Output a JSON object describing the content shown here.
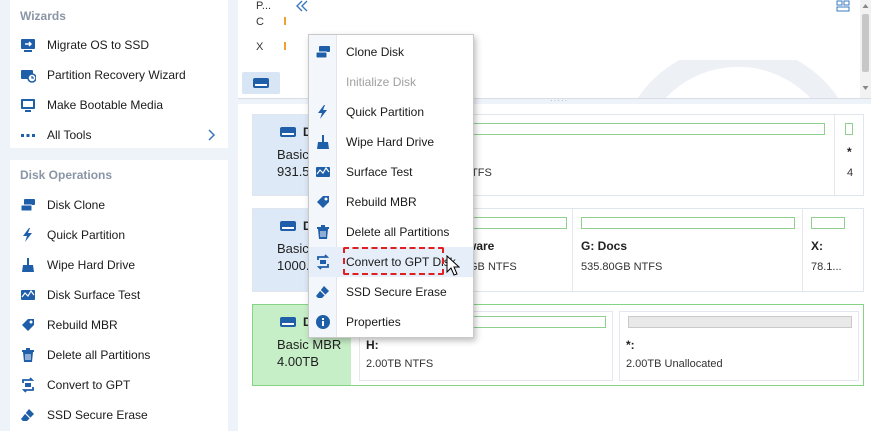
{
  "sidebar": {
    "wizards": {
      "title": "Wizards",
      "items": [
        {
          "label": "Migrate OS to SSD",
          "icon": "migrate-icon"
        },
        {
          "label": "Partition Recovery Wizard",
          "icon": "recovery-icon"
        },
        {
          "label": "Make Bootable Media",
          "icon": "bootable-media-icon"
        },
        {
          "label": "All Tools",
          "icon": "more-icon"
        }
      ]
    },
    "operations": {
      "title": "Disk Operations",
      "items": [
        {
          "label": "Disk Clone",
          "icon": "disk-clone-icon"
        },
        {
          "label": "Quick Partition",
          "icon": "lightning-icon"
        },
        {
          "label": "Wipe Hard Drive",
          "icon": "broom-icon"
        },
        {
          "label": "Disk Surface Test",
          "icon": "surface-test-icon"
        },
        {
          "label": "Rebuild MBR",
          "icon": "rebuild-icon"
        },
        {
          "label": "Delete all Partitions",
          "icon": "trash-icon"
        },
        {
          "label": "Convert to GPT",
          "icon": "convert-icon"
        },
        {
          "label": "SSD Secure Erase",
          "icon": "eraser-icon"
        }
      ]
    }
  },
  "top": {
    "col_label": "P...",
    "row1": "C",
    "row2": "X"
  },
  "disks": [
    {
      "name": "D",
      "type": "Basic",
      "size": "931.5",
      "partitions": [
        {
          "label": "",
          "info": "TFS"
        },
        {
          "label": "*",
          "info": "4"
        }
      ]
    },
    {
      "name": "D",
      "type": "Basic",
      "size": "1000.",
      "partitions": [
        {
          "label": "ware",
          "info": "GB NTFS"
        },
        {
          "label": "G: Docs",
          "info": "535.80GB NTFS"
        },
        {
          "label": "X:",
          "info": "78.1..."
        }
      ]
    },
    {
      "name": "D",
      "type": "Basic MBR",
      "size": "4.00TB",
      "partitions": [
        {
          "label": "H:",
          "info": "2.00TB NTFS"
        },
        {
          "label": "*:",
          "info": "2.00TB Unallocated"
        }
      ]
    }
  ],
  "context_menu": {
    "items": [
      {
        "label": "Clone Disk",
        "icon": "disk-clone-icon",
        "disabled": false
      },
      {
        "label": "Initialize Disk",
        "icon": "",
        "disabled": true
      },
      {
        "label": "Quick Partition",
        "icon": "lightning-icon",
        "disabled": false
      },
      {
        "label": "Wipe Hard Drive",
        "icon": "broom-icon",
        "disabled": false
      },
      {
        "label": "Surface Test",
        "icon": "surface-test-icon",
        "disabled": false
      },
      {
        "label": "Rebuild MBR",
        "icon": "rebuild-icon",
        "disabled": false
      },
      {
        "label": "Delete all Partitions",
        "icon": "trash-icon",
        "disabled": false
      },
      {
        "label": "Convert to GPT Disk",
        "icon": "convert-icon",
        "disabled": false
      },
      {
        "label": "SSD Secure Erase",
        "icon": "eraser-icon",
        "disabled": false
      },
      {
        "label": "Properties",
        "icon": "info-icon",
        "disabled": false
      }
    ]
  },
  "colors": {
    "icon_blue": "#1f5ea8",
    "highlight_red": "#e02020",
    "selected_disk_green": "#c7efc7"
  }
}
